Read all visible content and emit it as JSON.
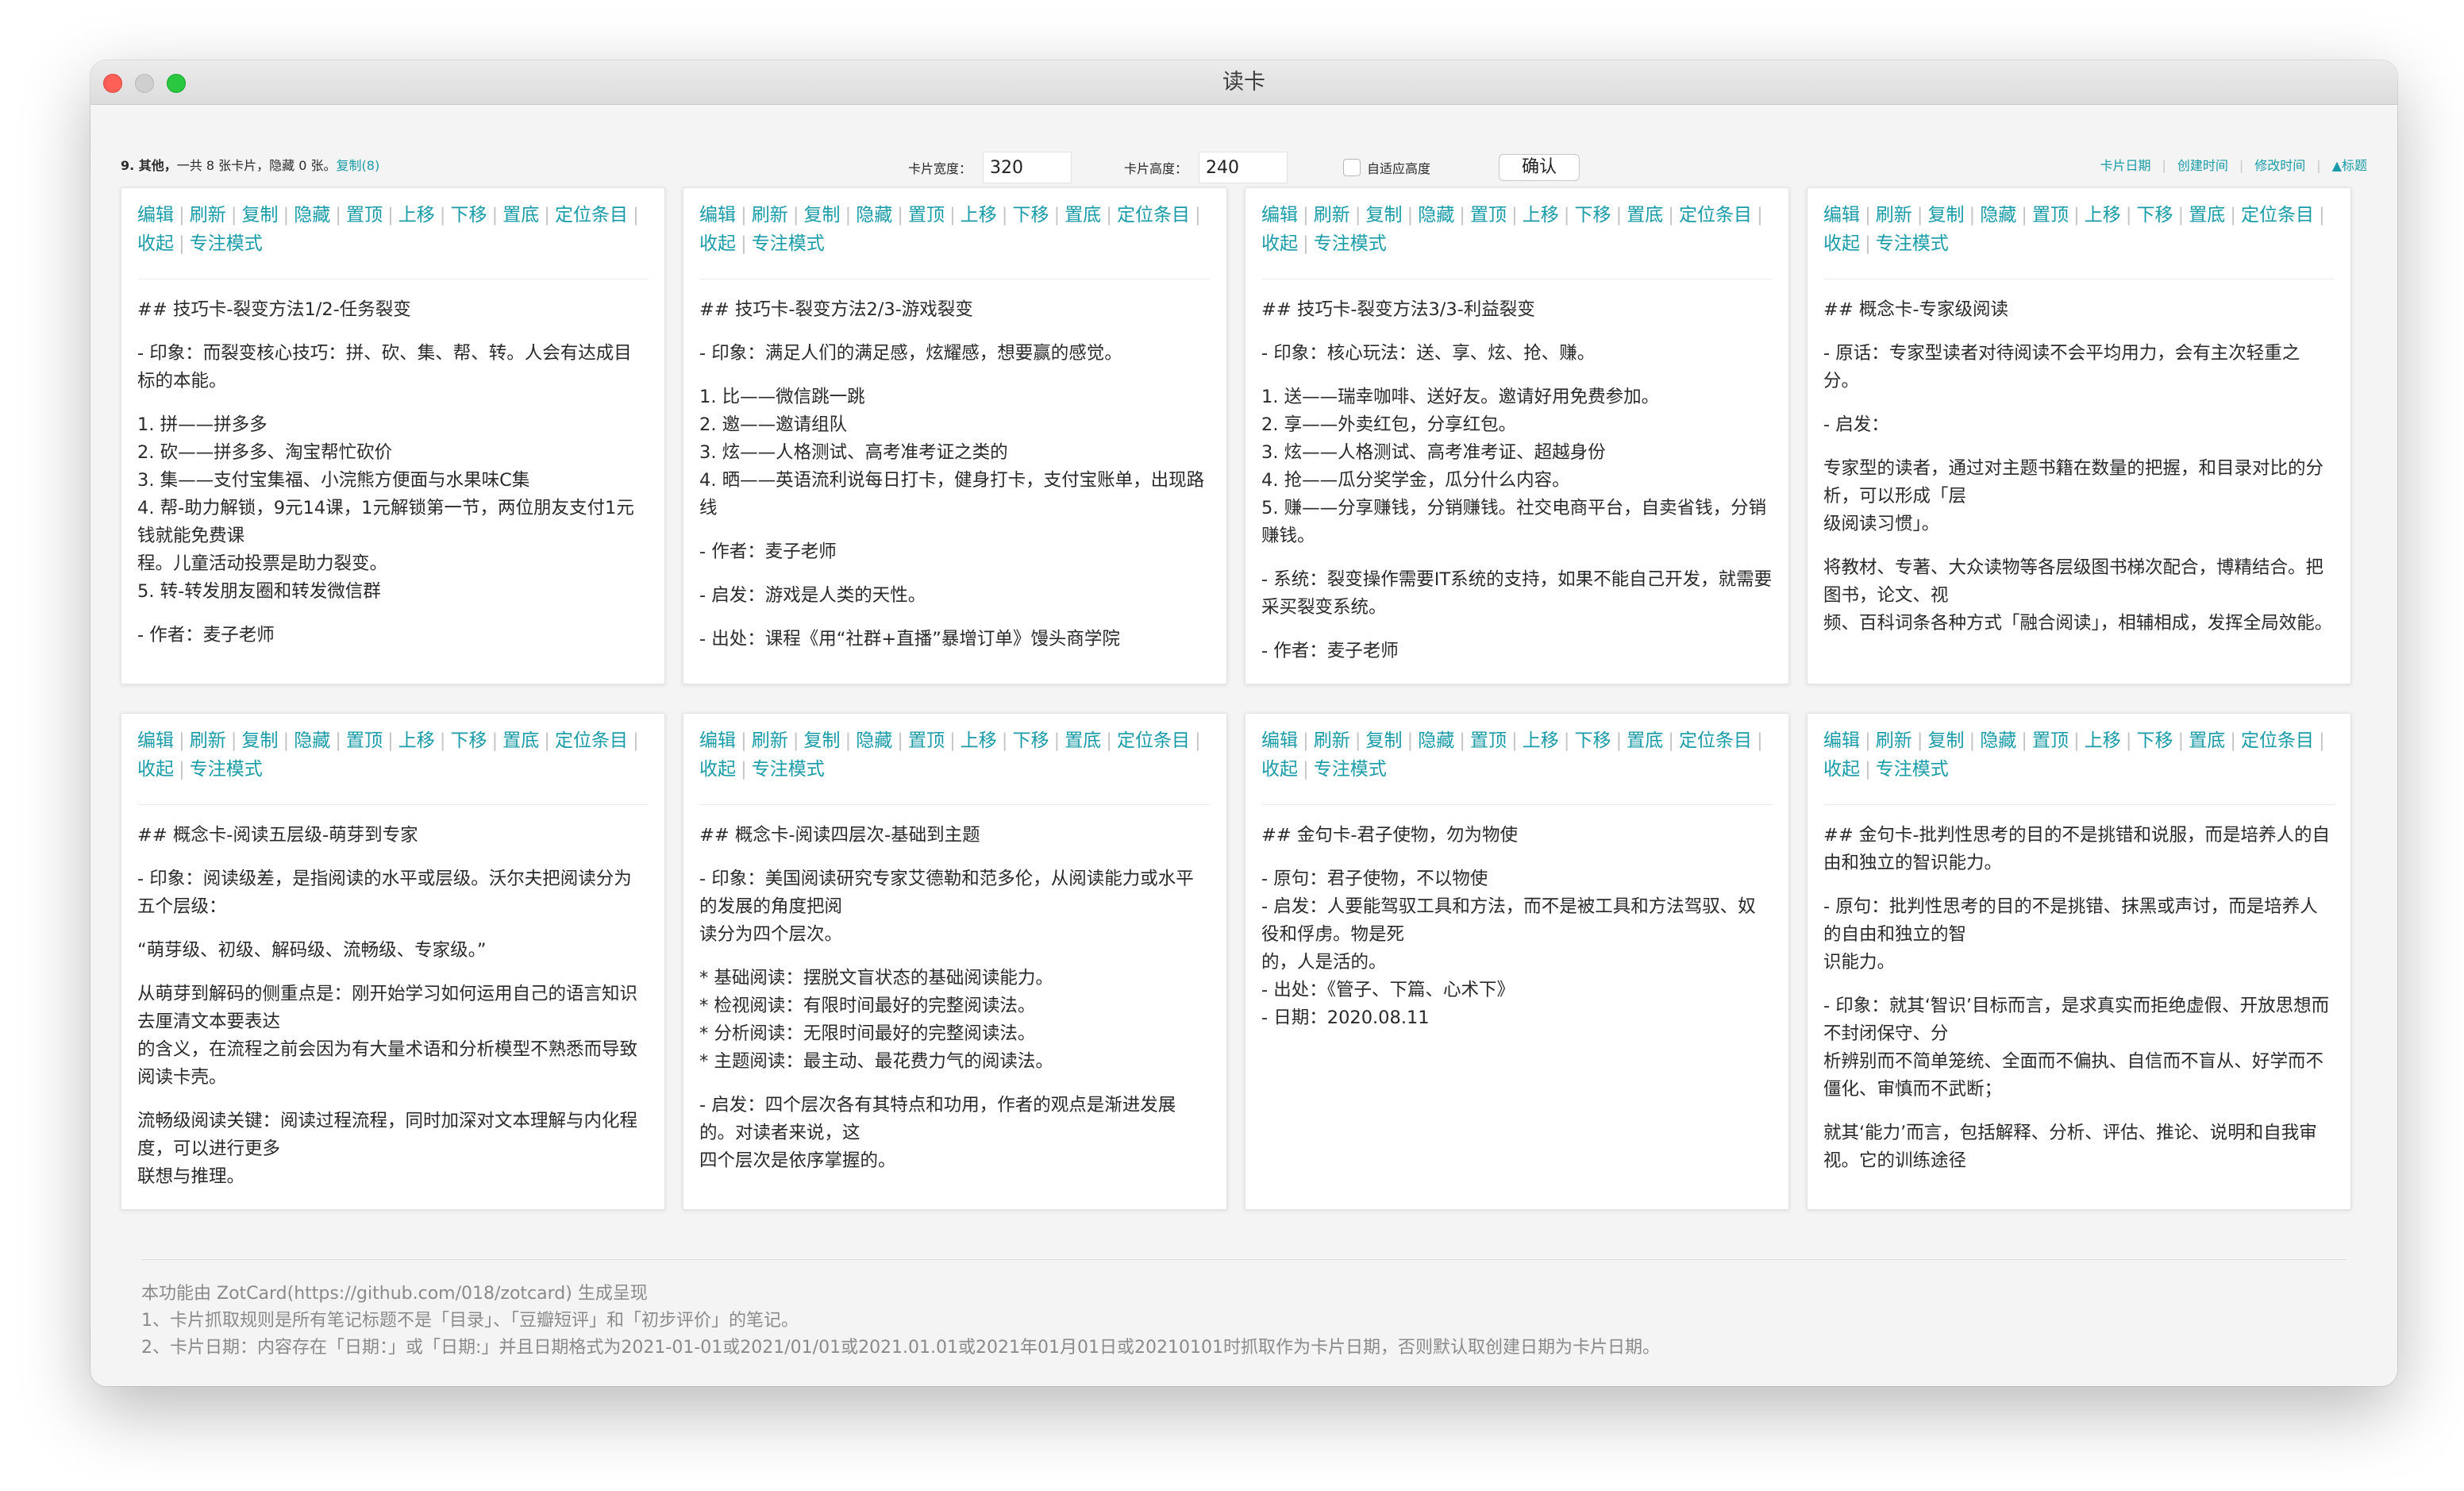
{
  "window": {
    "title": "读卡"
  },
  "toolbar": {
    "summary_prefix": "9. 其他，",
    "summary_text": "一共 8 张卡片，隐藏 0 张。",
    "copy_link": "复制(8)",
    "width_label": "卡片宽度：",
    "width_value": "320",
    "height_label": "卡片高度：",
    "height_value": "240",
    "auto_height_label": "自适应高度",
    "auto_height_checked": false,
    "confirm_label": "确认",
    "sort_options": [
      "卡片日期",
      "创建时间",
      "修改时间",
      "▲标题"
    ]
  },
  "card_actions": [
    "编辑",
    "刷新",
    "复制",
    "隐藏",
    "置顶",
    "上移",
    "下移",
    "置底",
    "定位条目",
    "收起",
    "专注模式"
  ],
  "cards": [
    {
      "paragraphs": [
        "## 技巧卡-裂变方法1/2-任务裂变",
        "- 印象：而裂变核心技巧：拼、砍、集、帮、转。人会有达成目标的本能。",
        "1. 拼——拼多多\n2. 砍——拼多多、淘宝帮忙砍价\n3. 集——支付宝集福、小浣熊方便面与水果味C集\n4. 帮-助力解锁，9元14课，1元解锁第一节，两位朋友支付1元钱就能免费课\n程。儿童活动投票是助力裂变。\n5. 转-转发朋友圈和转发微信群",
        "- 作者：麦子老师"
      ]
    },
    {
      "paragraphs": [
        "## 技巧卡-裂变方法2/3-游戏裂变",
        "- 印象：满足人们的满足感，炫耀感，想要赢的感觉。",
        "1. 比——微信跳一跳\n2. 邀——邀请组队\n3. 炫——人格测试、高考准考证之类的\n4. 晒——英语流利说每日打卡，健身打卡，支付宝账单，出现路线",
        "- 作者：麦子老师",
        "- 启发：游戏是人类的天性。",
        "- 出处：课程《用“社群+直播”暴增订单》馒头商学院"
      ]
    },
    {
      "paragraphs": [
        "## 技巧卡-裂变方法3/3-利益裂变",
        "- 印象：核心玩法：送、享、炫、抢、赚。",
        "1. 送——瑞幸咖啡、送好友。邀请好用免费参加。\n2. 享——外卖红包，分享红包。\n3. 炫——人格测试、高考准考证、超越身份\n4. 抢——瓜分奖学金，瓜分什么内容。\n5. 赚——分享赚钱，分销赚钱。社交电商平台，自卖省钱，分销赚钱。",
        "- 系统：裂变操作需要IT系统的支持，如果不能自己开发，就需要采买裂变系统。",
        "- 作者：麦子老师"
      ]
    },
    {
      "paragraphs": [
        "## 概念卡-专家级阅读",
        "- 原话：专家型读者对待阅读不会平均用力，会有主次轻重之分。",
        "- 启发：",
        "专家型的读者，通过对主题书籍在数量的把握，和目录对比的分析，可以形成「层\n级阅读习惯」。",
        "将教材、专著、大众读物等各层级图书梯次配合，博精结合。把图书，论文、视\n频、百科词条各种方式「融合阅读」，相辅相成，发挥全局效能。"
      ]
    },
    {
      "paragraphs": [
        "## 概念卡-阅读五层级-萌芽到专家",
        "- 印象：阅读级差，是指阅读的水平或层级。沃尔夫把阅读分为五个层级：",
        "“萌芽级、初级、解码级、流畅级、专家级。”",
        "从萌芽到解码的侧重点是：刚开始学习如何运用自己的语言知识去厘清文本要表达\n的含义，在流程之前会因为有大量术语和分析模型不熟悉而导致阅读卡壳。",
        "流畅级阅读关键：阅读过程流程，同时加深对文本理解与内化程度，可以进行更多\n联想与推理。"
      ]
    },
    {
      "paragraphs": [
        "## 概念卡-阅读四层次-基础到主题",
        "- 印象：美国阅读研究专家艾德勒和范多伦，从阅读能力或水平的发展的角度把阅\n读分为四个层次。",
        "* 基础阅读：摆脱文盲状态的基础阅读能力。\n* 检视阅读：有限时间最好的完整阅读法。\n* 分析阅读：无限时间最好的完整阅读法。\n* 主题阅读：最主动、最花费力气的阅读法。",
        "- 启发：四个层次各有其特点和功用，作者的观点是渐进发展的。对读者来说，这\n四个层次是依序掌握的。"
      ]
    },
    {
      "paragraphs": [
        "## 金句卡-君子使物，勿为物使",
        "- 原句：君子使物，不以物使\n- 启发：人要能驾驭工具和方法，而不是被工具和方法驾驭、奴役和俘虏。物是死\n的，人是活的。\n- 出处：《管子、下篇、心术下》\n- 日期：2020.08.11"
      ]
    },
    {
      "paragraphs": [
        "## 金句卡-批判性思考的目的不是挑错和说服，而是培养人的自由和独立的智识能力。",
        "- 原句：批判性思考的目的不是挑错、抹黑或声讨，而是培养人的自由和独立的智\n识能力。",
        "- 印象：就其‘智识’目标而言，是求真实而拒绝虚假、开放思想而不封闭保守、分\n析辨别而不简单笼统、全面而不偏执、自信而不盲从、好学而不僵化、审慎而不武断；",
        "就其‘能力’而言，包括解释、分析、评估、推论、说明和自我审视。它的训练途径"
      ]
    }
  ],
  "footer": {
    "lines": [
      "本功能由 ZotCard(https://github.com/018/zotcard) 生成呈现",
      "1、卡片抓取规则是所有笔记标题不是「目录」、「豆瓣短评」和「初步评价」的笔记。",
      "2、卡片日期：内容存在「日期：」或「日期:」并且日期格式为2021-01-01或2021/01/01或2021.01.01或2021年01月01日或20210101时抓取作为卡片日期，否则默认取创建日期为卡片日期。"
    ]
  }
}
